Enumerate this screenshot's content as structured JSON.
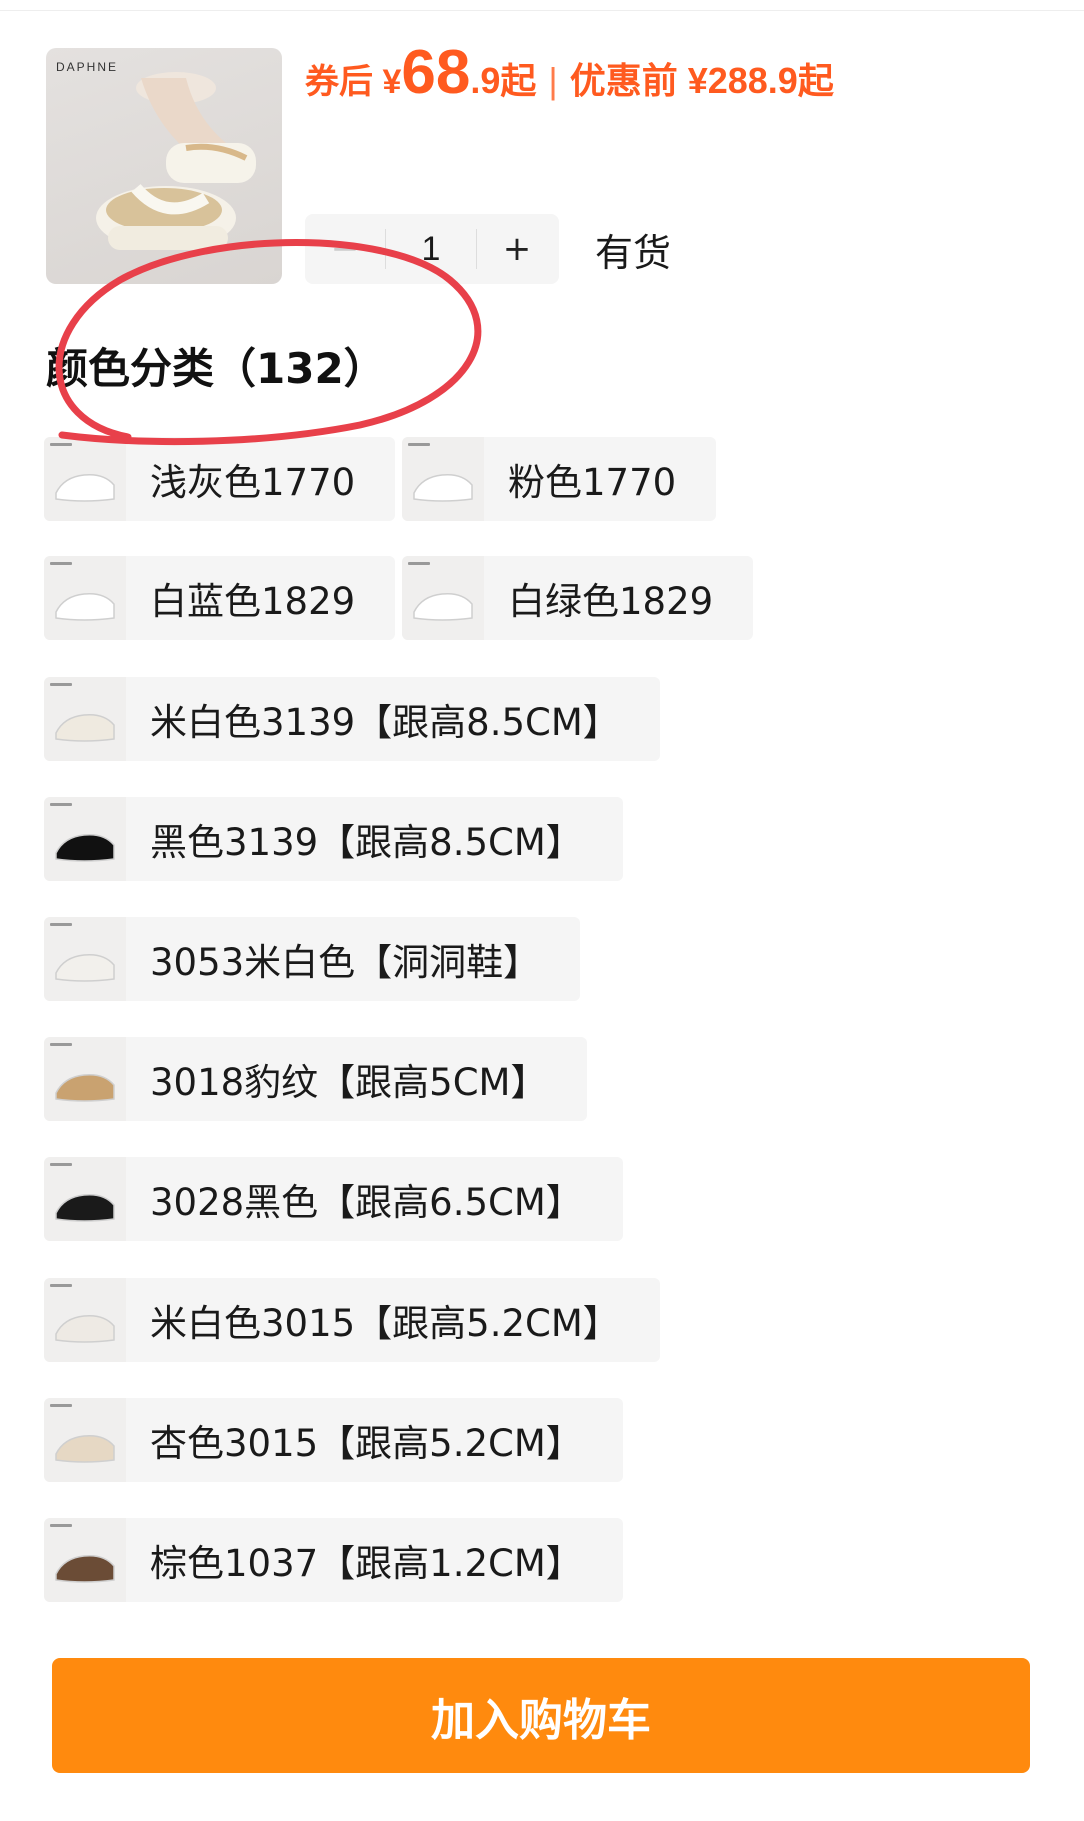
{
  "product": {
    "brand": "DAPHNE",
    "price": {
      "after_coupon_prefix": "券后 ¥",
      "after_coupon_int": "68",
      "after_coupon_dec": ".9起",
      "separator": "|",
      "before_discount": "优惠前 ¥288.9起"
    },
    "quantity": {
      "minus": "−",
      "value": "1",
      "plus": "+"
    },
    "stock_status": "有货"
  },
  "section": {
    "title": "颜色分类（132）"
  },
  "options": [
    {
      "label": "浅灰色1770",
      "swatch": "#ffffff"
    },
    {
      "label": "粉色1770",
      "swatch": "#ffffff"
    },
    {
      "label": "白蓝色1829",
      "swatch": "#ffffff"
    },
    {
      "label": "白绿色1829",
      "swatch": "#ffffff"
    },
    {
      "label": "米白色3139【跟高8.5CM】",
      "swatch": "#efeae0"
    },
    {
      "label": "黑色3139【跟高8.5CM】",
      "swatch": "#111111"
    },
    {
      "label": "3053米白色【洞洞鞋】",
      "swatch": "#f2f0ec"
    },
    {
      "label": "3018豹纹【跟高5CM】",
      "swatch": "#c9a270"
    },
    {
      "label": "3028黑色【跟高6.5CM】",
      "swatch": "#1a1a1a"
    },
    {
      "label": "米白色3015【跟高5.2CM】",
      "swatch": "#eeeae4"
    },
    {
      "label": "杏色3015【跟高5.2CM】",
      "swatch": "#e6d8c4"
    },
    {
      "label": "棕色1037【跟高1.2CM】",
      "swatch": "#6b4c36"
    }
  ],
  "cart_button": "加入购物车",
  "colors": {
    "accent": "#ff5a1f",
    "button": "#ff8a0e",
    "annotation": "#e8404a"
  }
}
